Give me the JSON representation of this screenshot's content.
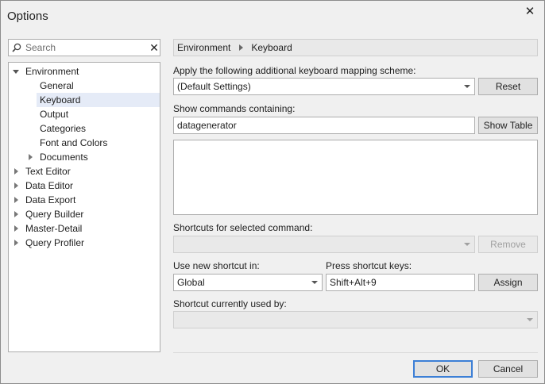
{
  "window": {
    "title": "Options",
    "close_glyph": "✕"
  },
  "search": {
    "placeholder": "Search",
    "clear_glyph": "✕"
  },
  "tree": [
    {
      "label": "Environment",
      "level": 0,
      "expander": "expanded",
      "selected": false
    },
    {
      "label": "General",
      "level": 1,
      "expander": "none",
      "selected": false
    },
    {
      "label": "Keyboard",
      "level": 1,
      "expander": "none",
      "selected": true
    },
    {
      "label": "Output",
      "level": 1,
      "expander": "none",
      "selected": false
    },
    {
      "label": "Categories",
      "level": 1,
      "expander": "none",
      "selected": false
    },
    {
      "label": "Font and Colors",
      "level": 1,
      "expander": "none",
      "selected": false
    },
    {
      "label": "Documents",
      "level": 1,
      "expander": "collapsed",
      "selected": false
    },
    {
      "label": "Text Editor",
      "level": 0,
      "expander": "collapsed",
      "selected": false
    },
    {
      "label": "Data Editor",
      "level": 0,
      "expander": "collapsed",
      "selected": false
    },
    {
      "label": "Data Export",
      "level": 0,
      "expander": "collapsed",
      "selected": false
    },
    {
      "label": "Query Builder",
      "level": 0,
      "expander": "collapsed",
      "selected": false
    },
    {
      "label": "Master-Detail",
      "level": 0,
      "expander": "collapsed",
      "selected": false
    },
    {
      "label": "Query Profiler",
      "level": 0,
      "expander": "collapsed",
      "selected": false
    }
  ],
  "breadcrumb": {
    "part1": "Environment",
    "part2": "Keyboard"
  },
  "mapping": {
    "label": "Apply the following additional keyboard mapping scheme:",
    "value": "(Default Settings)",
    "reset_label": "Reset"
  },
  "commands": {
    "label": "Show commands containing:",
    "value": "datagenerator",
    "show_table_label": "Show Table"
  },
  "shortcuts": {
    "label": "Shortcuts for selected command:",
    "value": "",
    "remove_label": "Remove"
  },
  "use_new": {
    "label": "Use new shortcut in:",
    "value": "Global"
  },
  "press_keys": {
    "label": "Press shortcut keys:",
    "value": "Shift+Alt+9",
    "assign_label": "Assign"
  },
  "used_by": {
    "label": "Shortcut currently used by:",
    "value": ""
  },
  "footer": {
    "ok_label": "OK",
    "cancel_label": "Cancel"
  },
  "colors": {
    "accent": "#3c7fd6",
    "selection": "#e5ebf7"
  }
}
